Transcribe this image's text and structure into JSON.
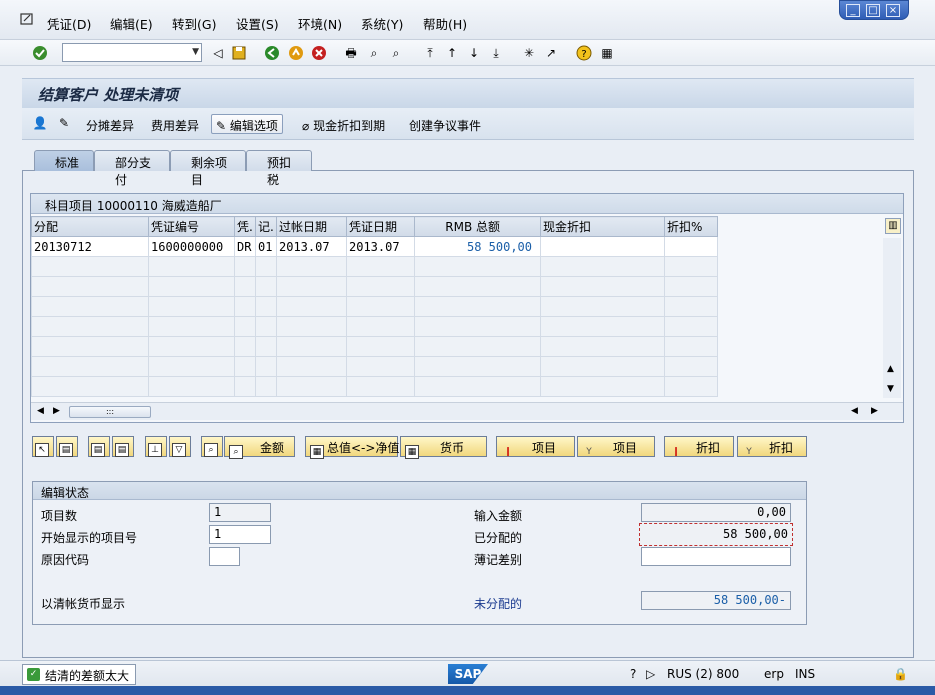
{
  "menu": {
    "items": [
      "凭证(D)",
      "编辑(E)",
      "转到(G)",
      "设置(S)",
      "环境(N)",
      "系统(Y)",
      "帮助(H)"
    ]
  },
  "window_controls": [
    "_",
    "□",
    "×"
  ],
  "title": "结算客户 处理未清项",
  "app_toolbar": {
    "distribute_diff": "分摊差异",
    "expense_diff": "费用差异",
    "edit_options": "编辑选项",
    "cash_discount_due": "现金折扣到期",
    "create_dispute": "创建争议事件"
  },
  "tabs": [
    "标准",
    "部分支付",
    "剩余项目",
    "预扣税"
  ],
  "table": {
    "caption": "科目项目 10000110 海威造船厂",
    "headers": [
      "分配",
      "凭证编号",
      "凭.",
      "记.",
      "过帐日期",
      "凭证日期",
      "RMB 总额",
      "现金折扣",
      "折扣%"
    ],
    "rows": [
      [
        "20130712",
        "1600000000",
        "DR",
        "01",
        "2013.07",
        "2013.07",
        "58 500,00",
        "",
        ""
      ]
    ],
    "thumb_marker": ":::"
  },
  "action_buttons": {
    "amount": "金额",
    "gross_net": "总值<->净值",
    "currency": "货币",
    "item_activate": "项目",
    "item_deactivate": "项目",
    "discount_activate": "折扣",
    "discount_deactivate": "折扣"
  },
  "edit_status": {
    "title": "编辑状态",
    "item_count_label": "项目数",
    "item_count_value": "1",
    "first_item_label": "开始显示的项目号",
    "first_item_value": "1",
    "reason_code_label": "原因代码",
    "reason_code_value": "",
    "display_currency_label": "以清帐货币显示",
    "input_amount_label": "输入金额",
    "input_amount_value": "0,00",
    "assigned_label": "已分配的",
    "assigned_value": "58 500,00",
    "posting_diff_label": "薄记差别",
    "posting_diff_value": "",
    "unassigned_label": "未分配的",
    "unassigned_value": "58 500,00-"
  },
  "status_bar": {
    "message": "结清的差额太大",
    "system": "RUS (2) 800",
    "client": "erp",
    "mode": "INS",
    "logo": "SAP"
  }
}
